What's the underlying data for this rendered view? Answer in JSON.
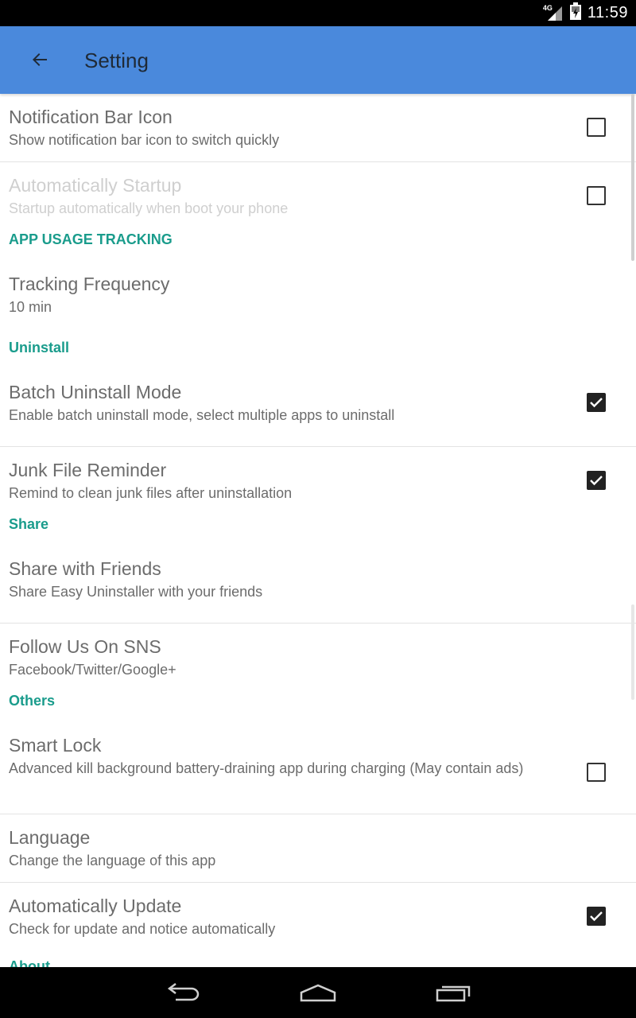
{
  "status_bar": {
    "network": "4G",
    "time": "11:59"
  },
  "app_bar": {
    "title": "Setting"
  },
  "settings": {
    "notification": {
      "title": "Notification Bar Icon",
      "summary": "Show notification bar icon to switch quickly",
      "checked": false
    },
    "startup": {
      "title": "Automatically Startup",
      "summary": "Startup automatically when boot your phone",
      "checked": false,
      "enabled": false
    },
    "cat_tracking": "APP USAGE TRACKING",
    "tracking_frequency": {
      "title": "Tracking Frequency",
      "summary": "10 min"
    },
    "cat_uninstall": "Uninstall",
    "batch_uninstall": {
      "title": "Batch Uninstall Mode",
      "summary": "Enable batch uninstall mode, select multiple apps to uninstall",
      "checked": true
    },
    "junk_reminder": {
      "title": "Junk File Reminder",
      "summary": "Remind to clean junk files after uninstallation",
      "checked": true
    },
    "cat_share": "Share",
    "share_friends": {
      "title": "Share with Friends",
      "summary": "Share Easy Uninstaller with your friends"
    },
    "follow_sns": {
      "title": "Follow Us On SNS",
      "summary": "Facebook/Twitter/Google+"
    },
    "cat_others": "Others",
    "smart_lock": {
      "title": "Smart Lock",
      "summary": "Advanced kill background battery-draining app during charging (May contain ads)",
      "checked": false
    },
    "language": {
      "title": "Language",
      "summary": "Change the language of this app"
    },
    "auto_update": {
      "title": "Automatically Update",
      "summary": "Check for update and notice automatically",
      "checked": true
    },
    "cat_about": "About"
  },
  "colors": {
    "app_bar": "#4a89dc",
    "category": "#1a9c8c",
    "text": "#6c6c6c",
    "disabled_text": "#cfcfcf"
  },
  "nav_bar": {
    "icons": [
      "back-icon",
      "home-icon",
      "recents-icon"
    ]
  }
}
